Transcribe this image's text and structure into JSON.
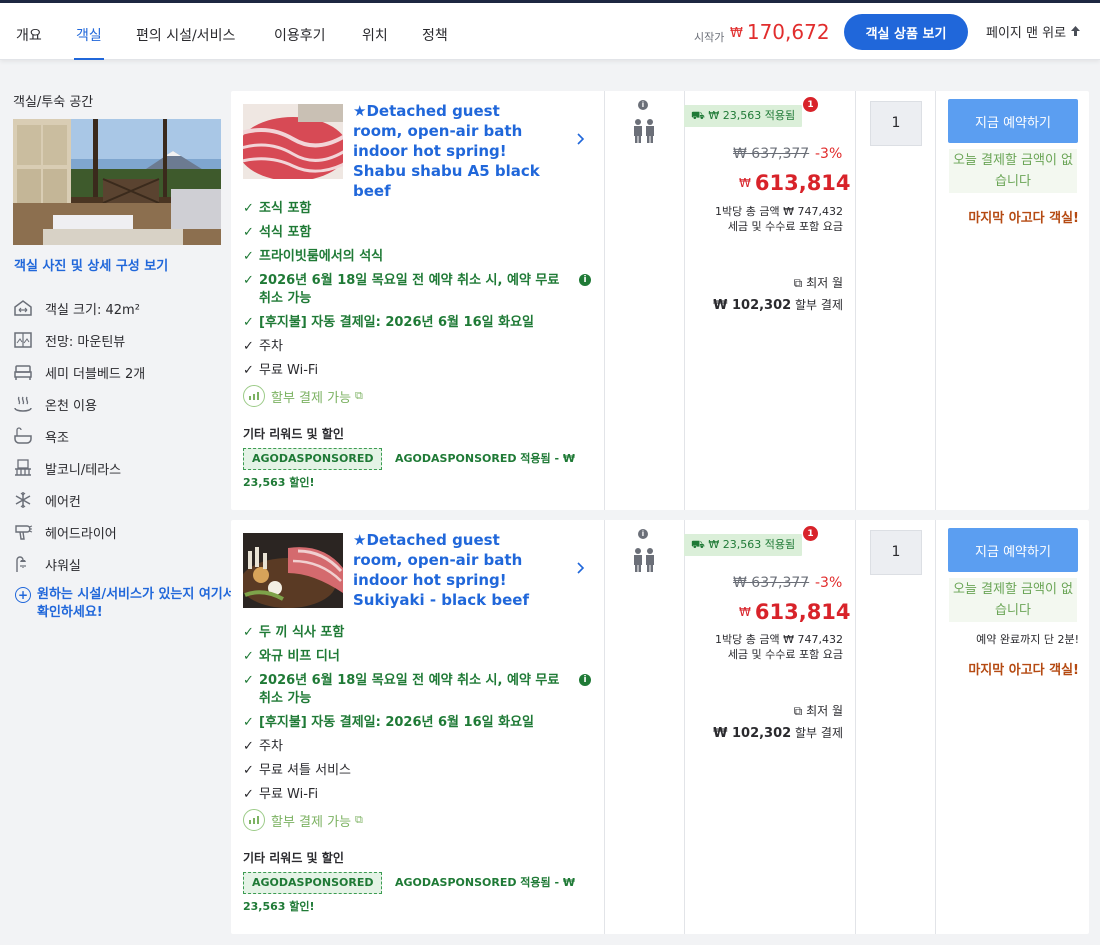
{
  "nav": {
    "tabs": [
      "개요",
      "객실",
      "편의 시설/서비스",
      "이용후기",
      "위치",
      "정책"
    ],
    "start_label": "시작가",
    "currency": "₩",
    "start_price": "170,672",
    "view_rooms_label": "객실 상품 보기",
    "to_top_label": "페이지 맨 위로"
  },
  "left": {
    "title": "객실/투숙 공간",
    "photo_link": "객실 사진 및 상세 구성 보기",
    "amenities": [
      {
        "label": "객실 크기: 42m²",
        "icon": "room-size-icon"
      },
      {
        "label": "전망: 마운틴뷰",
        "icon": "view-icon"
      },
      {
        "label": "세미 더블베드 2개",
        "icon": "bed-icon"
      },
      {
        "label": "온천 이용",
        "icon": "hot-spring-icon"
      },
      {
        "label": "욕조",
        "icon": "bathtub-icon"
      },
      {
        "label": "발코니/테라스",
        "icon": "balcony-icon"
      },
      {
        "label": "에어컨",
        "icon": "snowflake-icon"
      },
      {
        "label": "헤어드라이어",
        "icon": "hairdryer-icon"
      },
      {
        "label": "샤워실",
        "icon": "shower-icon"
      }
    ],
    "more_link": "원하는 시설/서비스가 있는지 여기서 확인하세요!"
  },
  "rooms": [
    {
      "title": "★Detached guest room, open-air bath indoor hot spring! Shabu shabu A5 black beef",
      "features": [
        {
          "text": "조식 포함",
          "green": true
        },
        {
          "text": "석식 포함",
          "green": true
        },
        {
          "text": "프라이빗룸에서의 석식",
          "green": true
        },
        {
          "text": "2026년 6월 18일 목요일 전 예약 취소 시, 예약 무료 취소 가능",
          "green": true,
          "info": true
        },
        {
          "text": "[후지불] 자동 결제일: 2026년 6월 16일 화요일",
          "green": true
        },
        {
          "text": "주차",
          "green": false
        },
        {
          "text": "무료 Wi-Fi",
          "green": false
        }
      ],
      "installment": "할부 결제 가능",
      "other_title": "기타 리워드 및 할인",
      "sponsor_tag": "AGODASPONSORED",
      "sponsor_desc": "AGODASPONSORED 적용됨 - ₩ 23,563 할인!",
      "promo": "₩ 23,563 적용됨",
      "promo_badge": "1",
      "old_price": "₩ 637,377",
      "discount": "-3%",
      "price": "613,814",
      "per_night_1": "1박당 총 금액 ₩ 747,432",
      "per_night_2": "세금 및 수수료 포함 요금",
      "min_monthly": "최저 월",
      "monthly_amount": "₩ 102,302",
      "monthly_suffix": "할부 결제",
      "quantity": "1",
      "book_label": "지금 예약하기",
      "no_pay": "오늘 결제할 금액이 없습니다",
      "booked_note": "",
      "urgent": "마지막 아고다 객실!"
    },
    {
      "title": "★Detached guest room, open-air bath indoor hot spring! Sukiyaki - black beef",
      "features": [
        {
          "text": "두 끼 식사 포함",
          "green": true
        },
        {
          "text": "와규 비프 디너",
          "green": true
        },
        {
          "text": "2026년 6월 18일 목요일 전 예약 취소 시, 예약 무료 취소 가능",
          "green": true,
          "info": true
        },
        {
          "text": "[후지불] 자동 결제일: 2026년 6월 16일 화요일",
          "green": true
        },
        {
          "text": "주차",
          "green": false
        },
        {
          "text": "무료 셔틀 서비스",
          "green": false
        },
        {
          "text": "무료 Wi-Fi",
          "green": false
        }
      ],
      "installment": "할부 결제 가능",
      "other_title": "기타 리워드 및 할인",
      "sponsor_tag": "AGODASPONSORED",
      "sponsor_desc": "AGODASPONSORED 적용됨 - ₩ 23,563 할인!",
      "promo": "₩ 23,563 적용됨",
      "promo_badge": "1",
      "old_price": "₩ 637,377",
      "discount": "-3%",
      "price": "613,814",
      "per_night_1": "1박당 총 금액 ₩ 747,432",
      "per_night_2": "세금 및 수수료 포함 요금",
      "min_monthly": "최저 월",
      "monthly_amount": "₩ 102,302",
      "monthly_suffix": "할부 결제",
      "quantity": "1",
      "book_label": "지금 예약하기",
      "no_pay": "오늘 결제할 금액이 없습니다",
      "booked_note": "예약 완료까지 단 2분!",
      "urgent": "마지막 아고다 객실!"
    }
  ],
  "colors": {
    "accent": "#2067da",
    "price_red": "#d8232a",
    "green": "#1f7a36",
    "urgent": "#b54a12"
  }
}
